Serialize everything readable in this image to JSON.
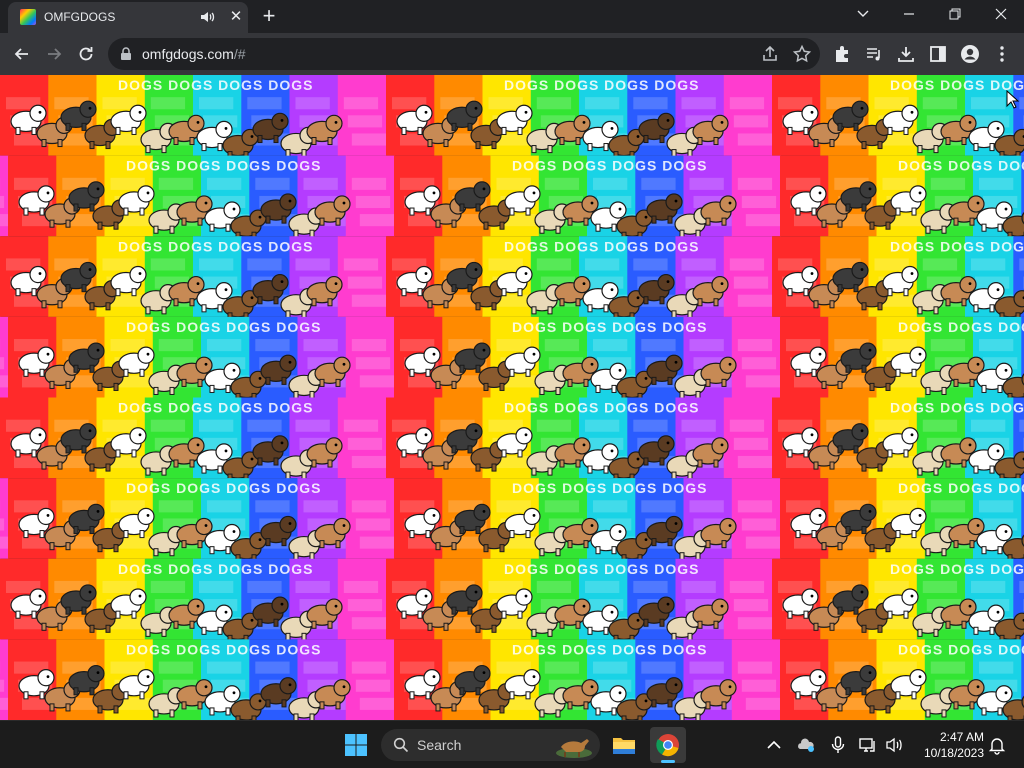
{
  "browser": {
    "tab": {
      "title": "OMFGDOGS",
      "close_glyph": "✕",
      "audio_icon": "speaker-icon"
    },
    "new_tab_glyph": "+",
    "url": {
      "host": "omfgdogs.com",
      "path": "/#"
    }
  },
  "page": {
    "background_stripes": [
      "#ff2a2a",
      "#ff8a00",
      "#ffe600",
      "#33e533",
      "#19d3e6",
      "#2a5cff",
      "#b43cff",
      "#ff3ccf"
    ],
    "tile_word": "DOGS",
    "rows": 8,
    "dog_colors": [
      "#ffffff",
      "#777777",
      "#3b3b3b",
      "#c78a55",
      "#8a5a2e",
      "#e9d9b8",
      "#5a3b22"
    ]
  },
  "taskbar": {
    "search_placeholder": "Search",
    "time": "2:47 AM",
    "date": "10/18/2023"
  }
}
